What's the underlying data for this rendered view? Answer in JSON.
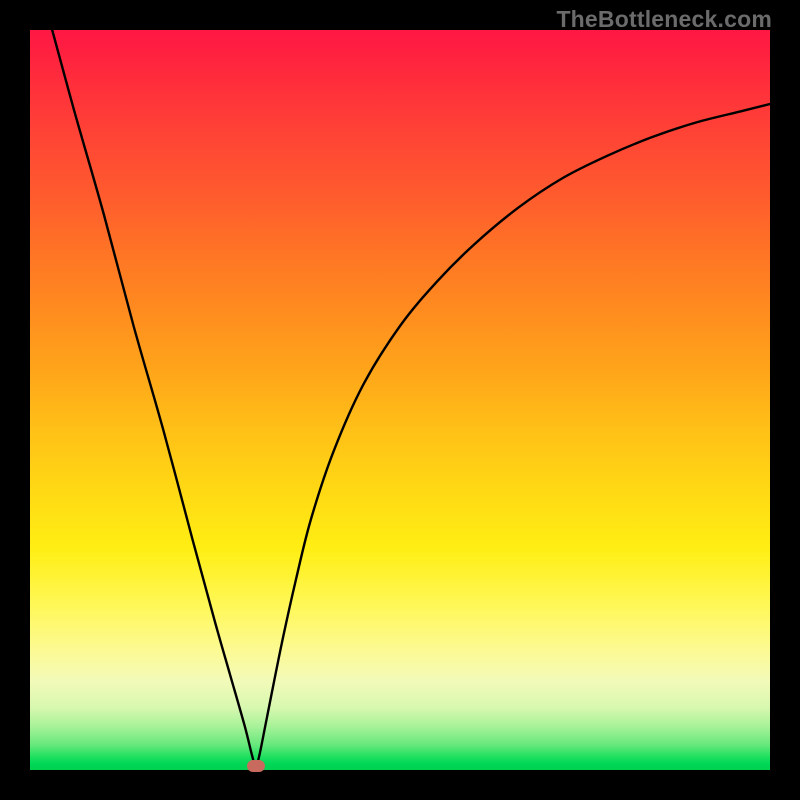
{
  "watermark": "TheBottleneck.com",
  "chart_data": {
    "type": "line",
    "title": "",
    "xlabel": "",
    "ylabel": "",
    "xlim": [
      0,
      100
    ],
    "ylim": [
      0,
      100
    ],
    "x": [
      3,
      6,
      10,
      14,
      18,
      22,
      25,
      27,
      29,
      30,
      30.5,
      31,
      32,
      34,
      36,
      38,
      41,
      45,
      50,
      55,
      60,
      66,
      72,
      78,
      84,
      90,
      96,
      100
    ],
    "values": [
      100,
      89,
      75,
      60,
      46,
      31,
      20,
      13,
      6,
      2,
      0.5,
      2,
      7,
      17,
      26,
      34,
      43,
      52,
      60,
      66,
      71,
      76,
      80,
      83,
      85.5,
      87.5,
      89,
      90
    ],
    "minimum_point": {
      "x": 30.5,
      "y": 0.5
    },
    "gradient_bands": [
      {
        "label": "red",
        "y_range": [
          70,
          100
        ]
      },
      {
        "label": "orange",
        "y_range": [
          40,
          70
        ]
      },
      {
        "label": "yellow",
        "y_range": [
          10,
          40
        ]
      },
      {
        "label": "green",
        "y_range": [
          0,
          10
        ]
      }
    ],
    "annotations": [
      {
        "type": "marker",
        "shape": "ellipse",
        "x": 30.5,
        "y": 0.5,
        "color": "#c96a5e"
      }
    ]
  }
}
